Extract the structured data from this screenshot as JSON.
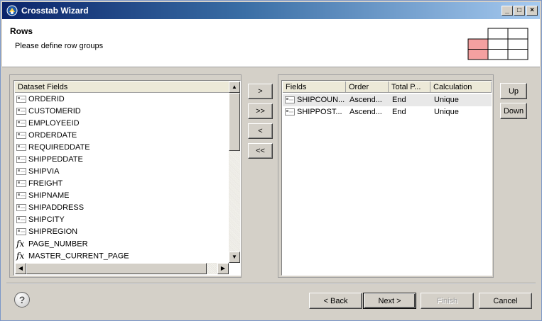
{
  "window": {
    "title": "Crosstab Wizard"
  },
  "header": {
    "title": "Rows",
    "subtitle": "Please define row groups"
  },
  "dataset": {
    "header": "Dataset Fields",
    "fields": [
      {
        "label": "ORDERID",
        "icon": "field-icon"
      },
      {
        "label": "CUSTOMERID",
        "icon": "field-icon"
      },
      {
        "label": "EMPLOYEEID",
        "icon": "field-icon"
      },
      {
        "label": "ORDERDATE",
        "icon": "field-icon"
      },
      {
        "label": "REQUIREDDATE",
        "icon": "field-icon"
      },
      {
        "label": "SHIPPEDDATE",
        "icon": "field-icon"
      },
      {
        "label": "SHIPVIA",
        "icon": "field-icon"
      },
      {
        "label": "FREIGHT",
        "icon": "field-icon"
      },
      {
        "label": "SHIPNAME",
        "icon": "field-icon"
      },
      {
        "label": "SHIPADDRESS",
        "icon": "field-icon"
      },
      {
        "label": "SHIPCITY",
        "icon": "field-icon"
      },
      {
        "label": "SHIPREGION",
        "icon": "field-icon"
      },
      {
        "label": "PAGE_NUMBER",
        "icon": "fx-icon"
      },
      {
        "label": "MASTER_CURRENT_PAGE",
        "icon": "fx-icon"
      }
    ]
  },
  "transfer": {
    "add": ">",
    "add_all": ">>",
    "remove": "<",
    "remove_all": "<<"
  },
  "groups": {
    "columns": [
      "Fields",
      "Order",
      "Total P...",
      "Calculation"
    ],
    "rows": [
      {
        "field": "SHIPCOUN...",
        "order": "Ascend...",
        "total": "End",
        "calculation": "Unique"
      },
      {
        "field": "SHIPPOST...",
        "order": "Ascend...",
        "total": "End",
        "calculation": "Unique"
      }
    ]
  },
  "order_buttons": {
    "up": "Up",
    "down": "Down"
  },
  "footer": {
    "back": "< Back",
    "next": "Next >",
    "finish": "Finish",
    "cancel": "Cancel",
    "help": "?"
  },
  "colors": {
    "highlight": "#f4a0a0",
    "selection": "#e8e8e8"
  }
}
